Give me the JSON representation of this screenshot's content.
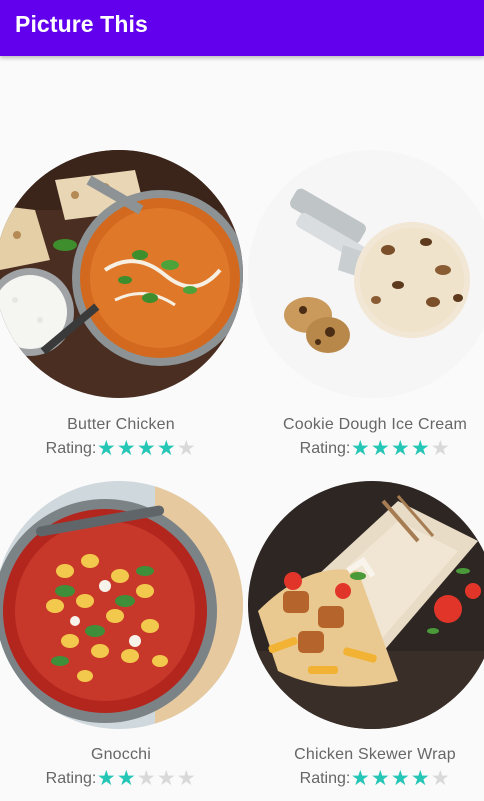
{
  "app": {
    "title": "Picture This"
  },
  "colors": {
    "app_bar": "#6200ee",
    "star_filled": "#26c6b7",
    "star_empty": "#d9d9d9",
    "text": "#666666"
  },
  "rating_label": "Rating:",
  "recipes": [
    {
      "name": "Butter Chicken",
      "rating": 4,
      "max_rating": 5,
      "image": "butter-chicken-photo"
    },
    {
      "name": "Cookie Dough Ice Cream",
      "rating": 4,
      "max_rating": 5,
      "image": "ice-cream-photo"
    },
    {
      "name": "Gnocchi",
      "rating": 2,
      "max_rating": 5,
      "image": "gnocchi-photo"
    },
    {
      "name": "Chicken Skewer Wrap",
      "rating": 4,
      "max_rating": 5,
      "image": "wrap-photo"
    }
  ]
}
